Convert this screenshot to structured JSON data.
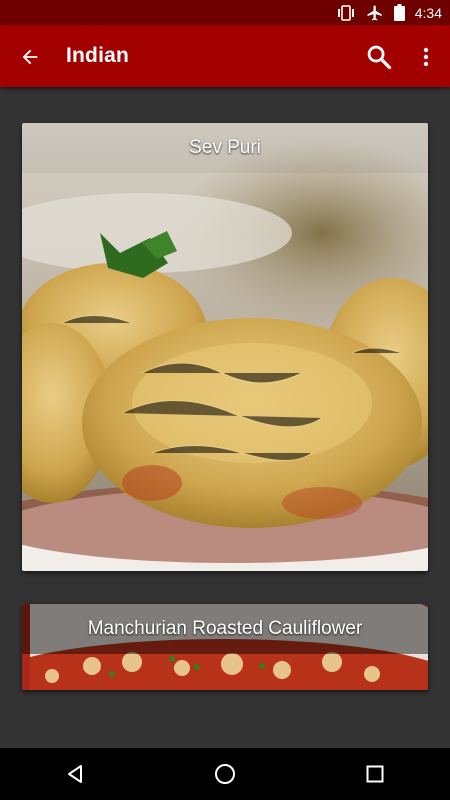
{
  "status_bar": {
    "time": "4:34",
    "icons": [
      "vibrate-icon",
      "airplane-mode-icon",
      "battery-icon"
    ]
  },
  "app_bar": {
    "title": "Indian",
    "back_icon": "arrow-back-icon",
    "search_icon": "search-icon",
    "more_icon": "more-vert-icon"
  },
  "recipes": [
    {
      "title": "Sev Puri"
    },
    {
      "title": "Manchurian Roasted Cauliflower"
    }
  ],
  "nav_bar": {
    "icons": [
      "back-triangle-icon",
      "home-circle-icon",
      "recents-square-icon"
    ]
  },
  "colors": {
    "status_bar": "#6f0000",
    "app_bar": "#a30000",
    "background": "#333333"
  }
}
